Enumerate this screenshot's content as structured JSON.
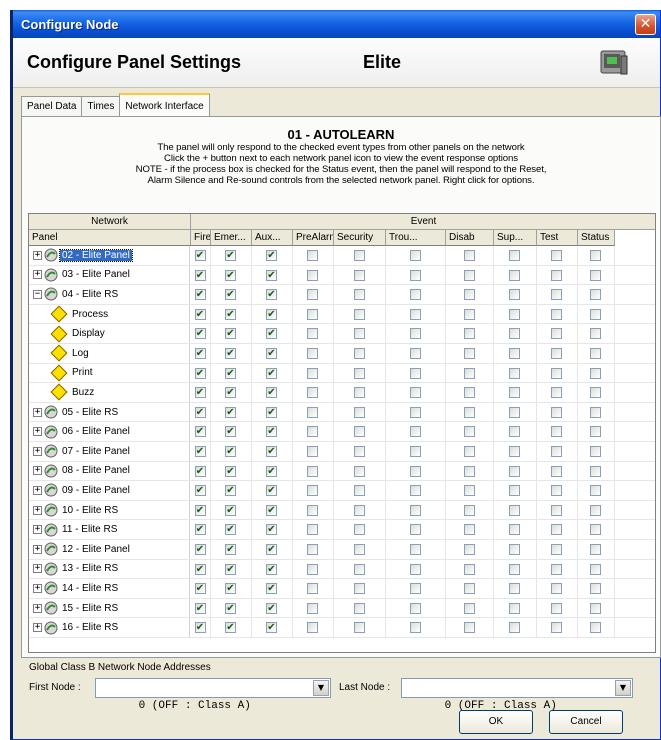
{
  "window": {
    "title": "Configure Node",
    "close_glyph": "✕"
  },
  "header": {
    "heading": "Configure Panel Settings",
    "model": "Elite",
    "icon": "panel-device-icon"
  },
  "tabs": [
    {
      "label": "Panel Data",
      "active": false
    },
    {
      "label": "Times",
      "active": false
    },
    {
      "label": "Network Interface",
      "active": true
    }
  ],
  "info": {
    "title": "01 - AUTOLEARN",
    "lines": [
      "The panel will only respond to the checked event types from other panels on the network",
      "Click the + button next to each network panel icon to view the event response options",
      "NOTE - if the process box is checked for the Status event, then the panel will respond to the Reset,",
      "Alarm Silence and Re-sound controls from the selected network panel. Right click for options."
    ]
  },
  "grid": {
    "group_headers": {
      "network": "Network",
      "event": "Event"
    },
    "panel_header": "Panel",
    "event_headers": [
      "Fire",
      "Emer...",
      "Aux...",
      "PreAlarm",
      "Security",
      "Trou...",
      "Disab",
      "Sup...",
      "Test",
      "Status"
    ],
    "rows": [
      {
        "kind": "node",
        "expander": "+",
        "label": "02 - Elite Panel",
        "selected": true,
        "checks": [
          true,
          true,
          true,
          false,
          false,
          false,
          false,
          false,
          false,
          false
        ]
      },
      {
        "kind": "node",
        "expander": "+",
        "label": "03 - Elite Panel",
        "selected": false,
        "checks": [
          true,
          true,
          true,
          false,
          false,
          false,
          false,
          false,
          false,
          false
        ]
      },
      {
        "kind": "node",
        "expander": "−",
        "label": "04 - Elite RS",
        "selected": false,
        "checks": [
          true,
          true,
          true,
          false,
          false,
          false,
          false,
          false,
          false,
          false
        ]
      },
      {
        "kind": "option",
        "label": "Process",
        "checks": [
          true,
          true,
          true,
          false,
          false,
          false,
          false,
          false,
          false,
          false
        ]
      },
      {
        "kind": "option",
        "label": "Display",
        "checks": [
          true,
          true,
          true,
          false,
          false,
          false,
          false,
          false,
          false,
          false
        ]
      },
      {
        "kind": "option",
        "label": "Log",
        "checks": [
          true,
          true,
          true,
          false,
          false,
          false,
          false,
          false,
          false,
          false
        ]
      },
      {
        "kind": "option",
        "label": "Print",
        "checks": [
          true,
          true,
          true,
          false,
          false,
          false,
          false,
          false,
          false,
          false
        ]
      },
      {
        "kind": "option",
        "label": "Buzz",
        "checks": [
          true,
          true,
          true,
          false,
          false,
          false,
          false,
          false,
          false,
          false
        ]
      },
      {
        "kind": "node",
        "expander": "+",
        "label": "05 - Elite RS",
        "selected": false,
        "checks": [
          true,
          true,
          true,
          false,
          false,
          false,
          false,
          false,
          false,
          false
        ]
      },
      {
        "kind": "node",
        "expander": "+",
        "label": "06 - Elite Panel",
        "selected": false,
        "checks": [
          true,
          true,
          true,
          false,
          false,
          false,
          false,
          false,
          false,
          false
        ]
      },
      {
        "kind": "node",
        "expander": "+",
        "label": "07 - Elite Panel",
        "selected": false,
        "checks": [
          true,
          true,
          true,
          false,
          false,
          false,
          false,
          false,
          false,
          false
        ]
      },
      {
        "kind": "node",
        "expander": "+",
        "label": "08 - Elite Panel",
        "selected": false,
        "checks": [
          true,
          true,
          true,
          false,
          false,
          false,
          false,
          false,
          false,
          false
        ]
      },
      {
        "kind": "node",
        "expander": "+",
        "label": "09 - Elite Panel",
        "selected": false,
        "checks": [
          true,
          true,
          true,
          false,
          false,
          false,
          false,
          false,
          false,
          false
        ]
      },
      {
        "kind": "node",
        "expander": "+",
        "label": "10 - Elite RS",
        "selected": false,
        "checks": [
          true,
          true,
          true,
          false,
          false,
          false,
          false,
          false,
          false,
          false
        ]
      },
      {
        "kind": "node",
        "expander": "+",
        "label": "11 - Elite RS",
        "selected": false,
        "checks": [
          true,
          true,
          true,
          false,
          false,
          false,
          false,
          false,
          false,
          false
        ]
      },
      {
        "kind": "node",
        "expander": "+",
        "label": "12 - Elite Panel",
        "selected": false,
        "checks": [
          true,
          true,
          true,
          false,
          false,
          false,
          false,
          false,
          false,
          false
        ]
      },
      {
        "kind": "node",
        "expander": "+",
        "label": "13 - Elite RS",
        "selected": false,
        "checks": [
          true,
          true,
          true,
          false,
          false,
          false,
          false,
          false,
          false,
          false
        ]
      },
      {
        "kind": "node",
        "expander": "+",
        "label": "14 - Elite RS",
        "selected": false,
        "checks": [
          true,
          true,
          true,
          false,
          false,
          false,
          false,
          false,
          false,
          false
        ]
      },
      {
        "kind": "node",
        "expander": "+",
        "label": "15 - Elite RS",
        "selected": false,
        "checks": [
          true,
          true,
          true,
          false,
          false,
          false,
          false,
          false,
          false,
          false
        ]
      },
      {
        "kind": "node",
        "expander": "+",
        "label": "16 - Elite RS",
        "selected": false,
        "checks": [
          true,
          true,
          true,
          false,
          false,
          false,
          false,
          false,
          false,
          false
        ]
      }
    ]
  },
  "bottom": {
    "group_label": "Global Class B Network Node Addresses",
    "first_node_label": "First Node :",
    "first_node_value": "0 (OFF : Class A)",
    "last_node_label": "Last Node :",
    "last_node_value": "0 (OFF : Class A)"
  },
  "buttons": {
    "ok": "OK",
    "cancel": "Cancel"
  },
  "colors": {
    "title_bar": "#0a52d6",
    "selection": "#316ac5",
    "dialog_bg": "#ece9d8"
  }
}
